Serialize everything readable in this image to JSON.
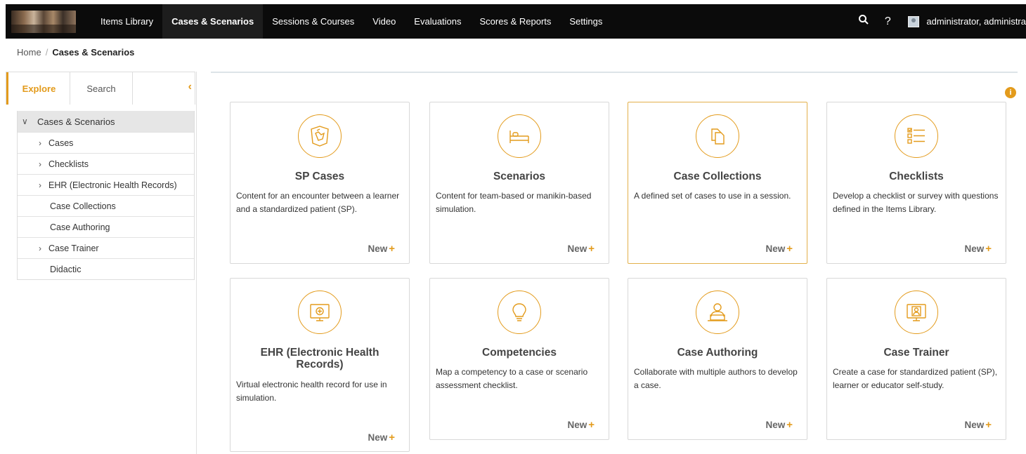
{
  "nav": {
    "items": [
      {
        "label": "Items Library",
        "active": false
      },
      {
        "label": "Cases & Scenarios",
        "active": true
      },
      {
        "label": "Sessions & Courses",
        "active": false
      },
      {
        "label": "Video",
        "active": false
      },
      {
        "label": "Evaluations",
        "active": false
      },
      {
        "label": "Scores & Reports",
        "active": false
      },
      {
        "label": "Settings",
        "active": false
      }
    ],
    "search_icon": "search-icon",
    "help_icon": "help-icon",
    "help_glyph": "?",
    "user_name": "administrator, administra"
  },
  "breadcrumb": {
    "home": "Home",
    "separator": "/",
    "current": "Cases & Scenarios"
  },
  "sidebar": {
    "tabs": [
      "Explore",
      "Search"
    ],
    "active_tab": "Explore",
    "tree": {
      "root": "Cases & Scenarios",
      "items": [
        {
          "label": "Cases",
          "expandable": true
        },
        {
          "label": "Checklists",
          "expandable": true
        },
        {
          "label": "EHR (Electronic Health Records)",
          "expandable": true
        },
        {
          "label": "Case Collections",
          "expandable": false
        },
        {
          "label": "Case Authoring",
          "expandable": false
        },
        {
          "label": "Case Trainer",
          "expandable": true
        },
        {
          "label": "Didactic",
          "expandable": false
        }
      ]
    }
  },
  "accent_color": "#e39b1c",
  "cards": [
    {
      "title": "SP Cases",
      "desc": "Content for an encounter between a learner and a standardized patient (SP).",
      "action": "New",
      "icon": "sp-cases-icon"
    },
    {
      "title": "Scenarios",
      "desc": "Content for team-based or manikin-based simulation.",
      "action": "New",
      "icon": "bed-icon"
    },
    {
      "title": "Case Collections",
      "desc": "A defined set of cases to use in a session.",
      "action": "New",
      "icon": "collection-icon"
    },
    {
      "title": "Checklists",
      "desc": "Develop a checklist or survey with questions defined in the Items Library.",
      "action": "New",
      "icon": "checklist-icon"
    },
    {
      "title": "EHR (Electronic Health Records)",
      "desc": "Virtual electronic health record for use in simulation.",
      "action": "New",
      "icon": "ehr-monitor-icon"
    },
    {
      "title": "Competencies",
      "desc": "Map a competency to a case or scenario assessment checklist.",
      "action": "New",
      "icon": "lightbulb-icon"
    },
    {
      "title": "Case Authoring",
      "desc": "Collaborate with multiple authors to develop a case.",
      "action": "New",
      "icon": "author-laptop-icon"
    },
    {
      "title": "Case Trainer",
      "desc": "Create a case for standardized patient (SP), learner or educator self-study.",
      "action": "New",
      "icon": "trainer-monitor-icon"
    }
  ]
}
